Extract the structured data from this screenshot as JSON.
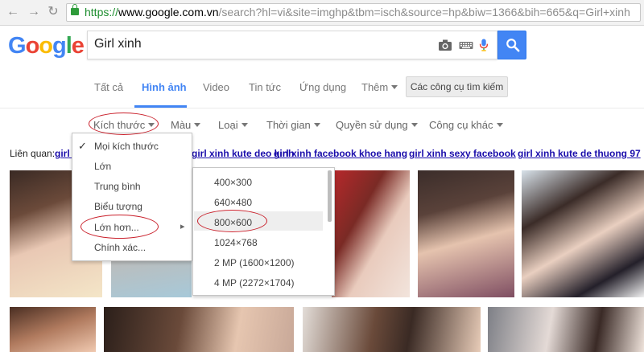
{
  "browser": {
    "back_glyph": "←",
    "forward_glyph": "→",
    "reload_glyph": "↻",
    "url_scheme": "https://",
    "url_host": "www.google.com.vn",
    "url_rest": "/search?hl=vi&site=imghp&tbm=isch&source=hp&biw=1366&bih=665&q=Girl+xinh"
  },
  "logo": [
    "G",
    "o",
    "o",
    "g",
    "l",
    "e"
  ],
  "logo_colors": [
    "#4285f4",
    "#ea4335",
    "#fbbc05",
    "#4285f4",
    "#34a853",
    "#ea4335"
  ],
  "search": {
    "query": "Girl xinh",
    "icons": [
      "camera-icon",
      "keyboard-icon",
      "microphone-icon",
      "search-icon"
    ]
  },
  "tabs": [
    {
      "label": "Tất cả"
    },
    {
      "label": "Hình ảnh"
    },
    {
      "label": "Video"
    },
    {
      "label": "Tin tức"
    },
    {
      "label": "Ứng dụng"
    },
    {
      "label": "Thêm"
    }
  ],
  "tools_button": "Các công cụ tìm kiếm",
  "tools": [
    "Kích thước",
    "Màu",
    "Loại",
    "Thời gian",
    "Quyền sử dụng",
    "Công cụ khác"
  ],
  "related": {
    "label": "Liên quan:",
    "links": [
      "girl x",
      "girl xinh kute deo kinh",
      "girl xinh facebook khoe hang",
      "girl xinh sexy facebook",
      "girl xinh kute de thuong 97"
    ]
  },
  "size_menu": {
    "items": [
      "Mọi kích thước",
      "Lớn",
      "Trung bình",
      "Biểu tượng",
      "Lớn hơn...",
      "Chính xác..."
    ],
    "checked_index": 0,
    "check_glyph": "✓",
    "arrow_glyph": "▸"
  },
  "larger_menu": {
    "items": [
      "400×300",
      "640×480",
      "800×600",
      "1024×768",
      "2 MP (1600×1200)",
      "4 MP (2272×1704)"
    ],
    "highlight_index": 2
  },
  "colors": {
    "accent": "#4285f4",
    "link": "#1a0dab",
    "annotation": "#c91f2a",
    "url_green": "#1e8e2f"
  }
}
